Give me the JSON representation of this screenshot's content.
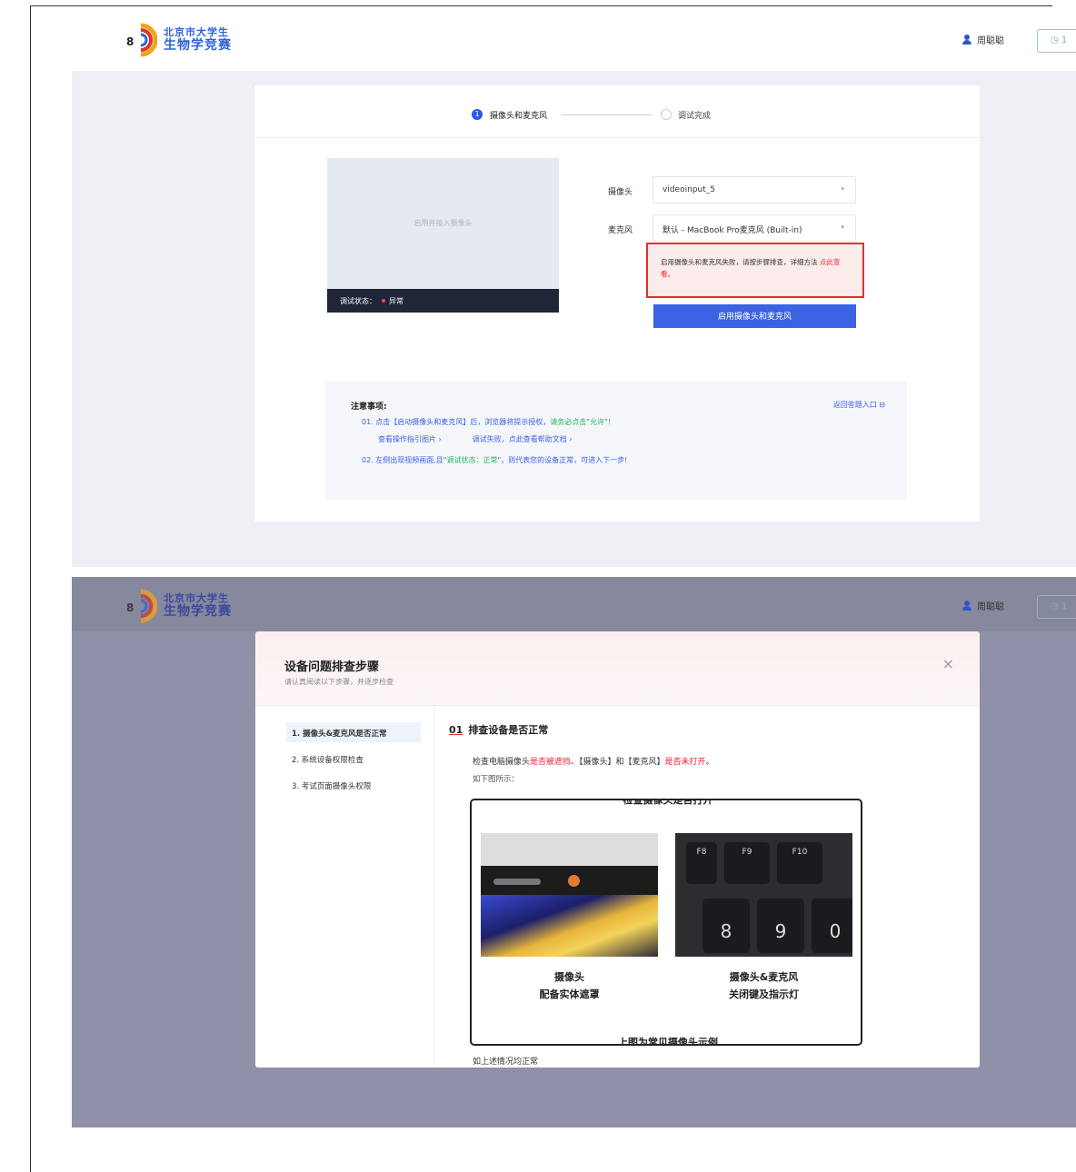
{
  "header": {
    "logo_line1": "北京市大学生",
    "logo_line2": "生物学竞赛",
    "user_name": "周聪聪",
    "timer_label": "◷ 1"
  },
  "setup": {
    "step1_label": "摄像头和麦克风",
    "step2_label": "调试完成",
    "preview_hint": "启用并接入摄像头",
    "status_label": "调试状态：",
    "status_value": "异常",
    "camera_label": "摄像头",
    "camera_value": "videoinput_5",
    "mic_label": "麦克风",
    "mic_value": "默认 - MacBook Pro麦克风 (Built-in)",
    "alert_text": "启用摄像头和麦克风失败，请按步骤排查，详细方法",
    "alert_link": "点此查看。",
    "enable_button": "启用摄像头和麦克风",
    "notes_title": "注意事项:",
    "notes_link": "返回答题入口 ⊟",
    "note1_a": "01. 点击【启动摄像头和麦克风】后，浏览器将提示授权，",
    "note1_b": "请务必点击\"允许\"！",
    "note1_sub_a": "查看操作指引图片 ›",
    "note1_sub_b": "调试失败，点此查看帮助文档 ›",
    "note2_a": "02. 左侧出现视频画面,且\"",
    "note2_b": "调试状态：正常",
    "note2_c": "\"，则代表您的设备正常，可进入下一步!"
  },
  "modal": {
    "title": "设备问题排查步骤",
    "subtitle": "请认真阅读以下步骤，并逐步检查",
    "close": "×",
    "steps": [
      {
        "label": "1. 摄像头&麦克风是否正常"
      },
      {
        "label": "2. 系统设备权限检查"
      },
      {
        "label": "3. 考试页面摄像头权限"
      }
    ],
    "q_num": "01",
    "q_title": "排查设备是否正常",
    "desc_a": "检查电脑摄像头",
    "desc_b": "是否被遮挡",
    "desc_c": "、【摄像头】和【麦克风】",
    "desc_d": "是否未打开",
    "desc_e": "。",
    "desc2": "如下图所示：",
    "illus_top": "检查摄像头是否打开",
    "fn_keys": [
      "F8",
      "F9",
      "F10"
    ],
    "num_keys": [
      "8",
      "9",
      "0"
    ],
    "cap1_line1": "摄像头",
    "cap1_line2": "配备实体遮罩",
    "cap2_line1": "摄像头&麦克风",
    "cap2_line2": "关闭键及指示灯",
    "illus_bottom": "上图为常见摄像头示例",
    "foot": "如上述情况均正常"
  }
}
